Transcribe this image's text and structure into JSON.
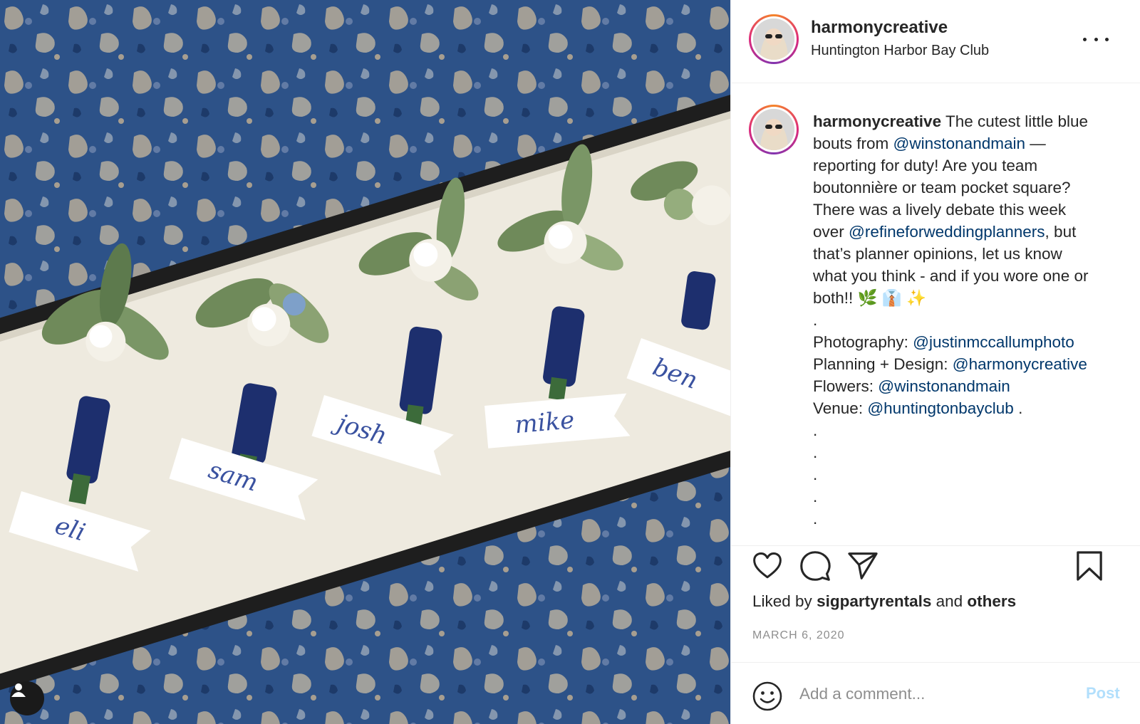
{
  "post": {
    "username": "harmonycreative",
    "location": "Huntington Harbor Bay Club",
    "caption": {
      "username": "harmonycreative",
      "l1": "The cutest little blue",
      "l2a": "bouts from ",
      "l2m": "@winstonandmain",
      "l2b": " —",
      "l3": "reporting for duty! Are you team",
      "l4": "boutonnière or team pocket square?",
      "l5": "There was a lively debate this week",
      "l6a": "over ",
      "l6m": "@refineforweddingplanners",
      "l6b": ", but",
      "l7": "that’s planner opinions, let us know",
      "l8": "what you think - and if you wore one or",
      "l9": "both!! 🌿 👔 ✨",
      "dot": ".",
      "photo_label": "Photography: ",
      "photo_mention": "@justinmccallumphoto",
      "planning_label": "Planning + Design: ",
      "planning_mention": "@harmonycreative",
      "flowers_label": "Flowers: ",
      "flowers_mention": "@winstonandmain",
      "venue_label": "Venue: ",
      "venue_mention": "@huntingtonbayclub",
      "venue_suffix": " ."
    },
    "likes": {
      "prefix": "Liked by ",
      "user": "sigpartyrentals",
      "middle": " and ",
      "others": "others"
    },
    "date": "MARCH 6, 2020"
  },
  "photo": {
    "tags": [
      "eli",
      "sam",
      "josh",
      "mike",
      "ben"
    ]
  },
  "comment": {
    "placeholder": "Add a comment...",
    "post_label": "Post"
  },
  "colors": {
    "mention": "#00376b",
    "post_disabled": "#b2dffc",
    "ribbon": "#1d2f6e",
    "rug_blue": "#2b4f86"
  }
}
